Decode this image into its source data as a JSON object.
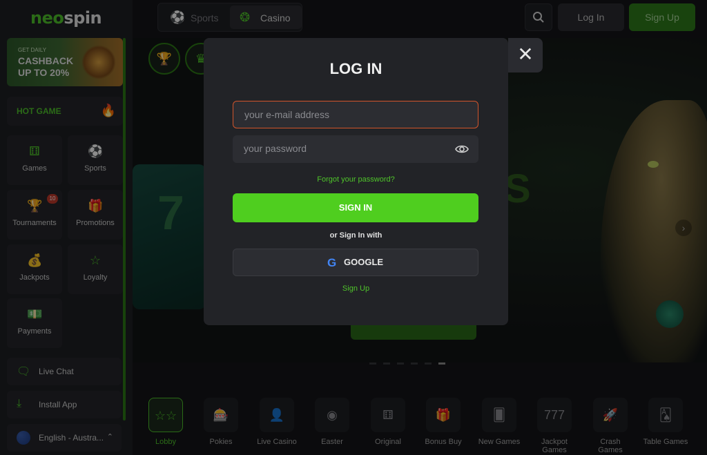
{
  "brand": {
    "logo_part1": "neo",
    "logo_part2": "spin",
    "accent": "#4fc42a"
  },
  "sidebar": {
    "promo": {
      "line1": "GET DAILY",
      "line2": "CASHBACK",
      "line3": "UP TO 20%"
    },
    "hot_game": {
      "label": "HOT GAME",
      "icon": "fire-icon"
    },
    "nav": [
      {
        "label": "Games",
        "icon": "dice-icon"
      },
      {
        "label": "Sports",
        "icon": "soccer-ball-icon"
      },
      {
        "label": "Tournaments",
        "icon": "trophy-icon",
        "badge": "10"
      },
      {
        "label": "Promotions",
        "icon": "gift-icon"
      },
      {
        "label": "Jackpots",
        "icon": "money-bag-icon"
      },
      {
        "label": "Loyalty",
        "icon": "star-icon"
      },
      {
        "label": "Payments",
        "icon": "cash-icon"
      }
    ],
    "live_chat": "Live Chat",
    "install_app": "Install App",
    "language": "English - Austra..."
  },
  "header": {
    "tabs": [
      {
        "label": "Sports",
        "icon": "soccer-ball-icon"
      },
      {
        "label": "Casino",
        "icon": "casino-chip-icon"
      }
    ],
    "login": "Log In",
    "signup": "Sign Up"
  },
  "modal": {
    "title": "LOG IN",
    "email_placeholder": "your e-mail address",
    "password_placeholder": "your password",
    "forgot": "Forgot your password?",
    "signin": "SIGN IN",
    "or_text": "or Sign In with",
    "google": "GOOGLE",
    "signup_link": "Sign Up"
  },
  "categories": [
    {
      "label": "Lobby",
      "icon": "stars-icon",
      "active": true
    },
    {
      "label": "Pokies",
      "icon": "slot-machine-icon"
    },
    {
      "label": "Live Casino",
      "icon": "dealer-icon"
    },
    {
      "label": "Easter",
      "icon": "easter-egg-icon"
    },
    {
      "label": "Original",
      "icon": "dice-icon"
    },
    {
      "label": "Bonus Buy",
      "icon": "gift-icon"
    },
    {
      "label": "New Games",
      "icon": "cards-icon"
    },
    {
      "label": "Jackpot Games",
      "icon": "triple-seven-icon"
    },
    {
      "label": "Crash Games",
      "icon": "rocket-icon"
    },
    {
      "label": "Table Games",
      "icon": "table-cards-icon"
    }
  ]
}
